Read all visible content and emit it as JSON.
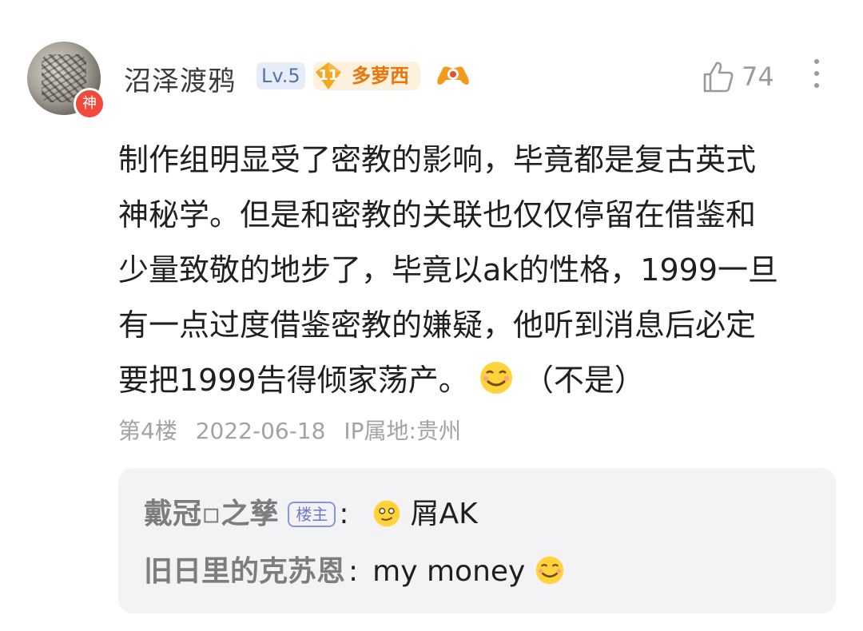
{
  "post": {
    "username": "沼泽渡鸦",
    "avatar_badge": "神",
    "level_badge": "Lv.5",
    "fan_badge": {
      "level": "11",
      "name": "多萝西"
    },
    "like_count": "74",
    "content": [
      "制作组明显受了密教的影响，毕竟都是复古英式",
      "神秘学。但是和密教的关联也仅仅停留在借鉴和",
      "少量致敬的地步了，毕竟以ak的性格，1999一旦",
      "有一点过度借鉴密教的嫌疑，他听到消息后必定"
    ],
    "content_last_before": "要把1999告得倾家荡产。",
    "content_last_after": "（不是）",
    "floor": "第4楼",
    "date": "2022-06-18",
    "ip": "IP属地:贵州"
  },
  "replies": [
    {
      "author": "戴冠▫之孳",
      "tag": "楼主",
      "colon": ":",
      "text": "屑AK"
    },
    {
      "author": "旧日里的克苏恩",
      "colon": ":",
      "text": "my money"
    }
  ],
  "icons": {
    "like": "thumbs-up-icon",
    "more": "vertical-dots-icon",
    "game": "game-controller-icon",
    "emoji": "smile-emoji-icon"
  }
}
